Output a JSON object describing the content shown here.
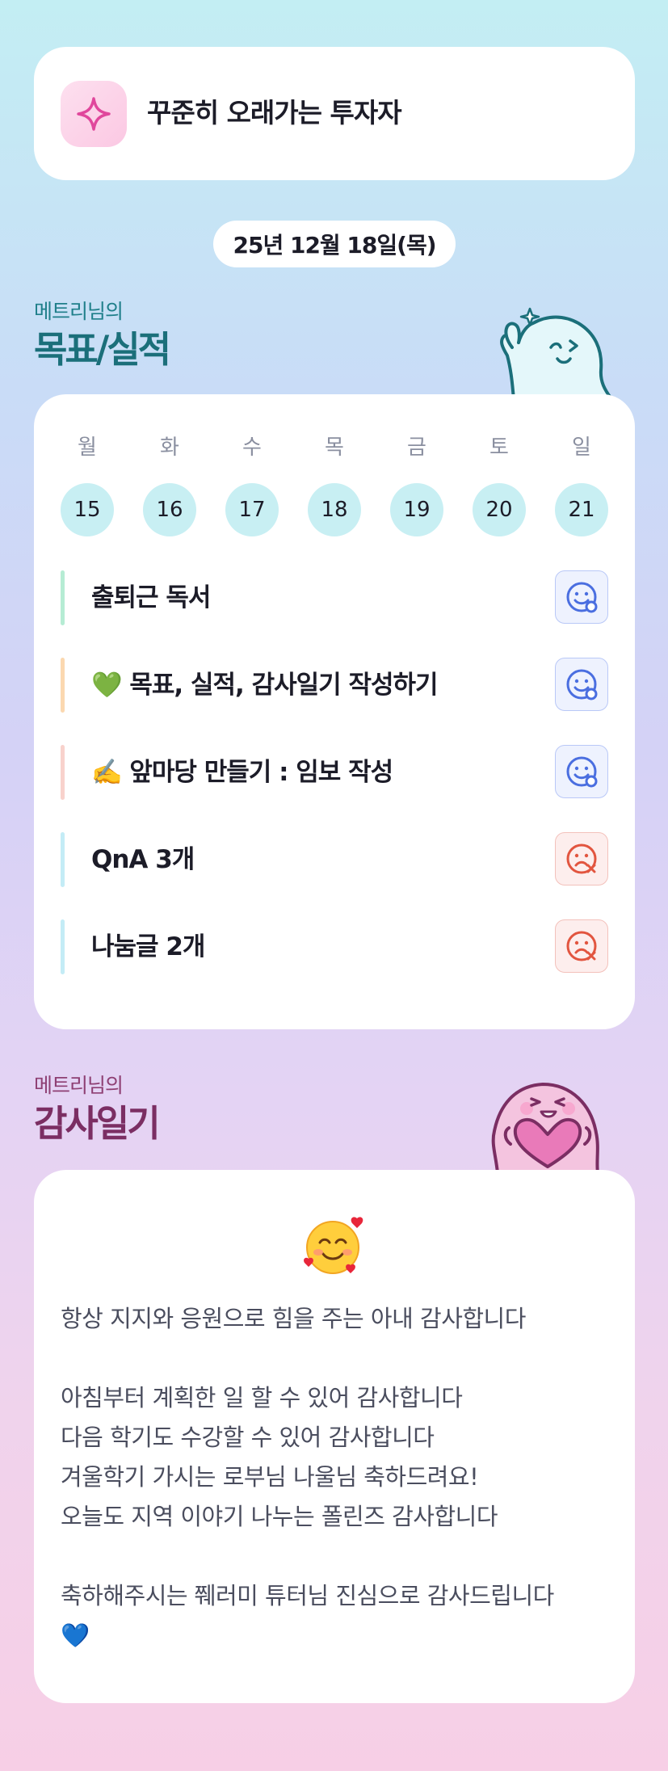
{
  "profile": {
    "title": "꾸준히 오래가는 투자자",
    "icon": "sparkle-icon",
    "accent": "#e0479c"
  },
  "date": "25년 12월 18일(목)",
  "goals_section": {
    "subtitle": "메트리님의",
    "title": "목표/실적"
  },
  "days": [
    {
      "label": "월",
      "num": "15"
    },
    {
      "label": "화",
      "num": "16"
    },
    {
      "label": "수",
      "num": "17"
    },
    {
      "label": "목",
      "num": "18"
    },
    {
      "label": "금",
      "num": "19"
    },
    {
      "label": "토",
      "num": "20"
    },
    {
      "label": "일",
      "num": "21"
    }
  ],
  "goals": [
    {
      "text": "출퇴근 독서",
      "bar_color": "#b6ecd4",
      "status": "done"
    },
    {
      "text": "💚 목표, 실적, 감사일기 작성하기",
      "bar_color": "#fbd8b0",
      "status": "done"
    },
    {
      "text": "✍️ 앞마당 만들기 : 임보 작성",
      "bar_color": "#f8d2cc",
      "status": "done"
    },
    {
      "text": "QnA 3개",
      "bar_color": "#c4ecf6",
      "status": "not-done"
    },
    {
      "text": "나눔글 2개",
      "bar_color": "#c4ecf6",
      "status": "not-done"
    }
  ],
  "thanks_section": {
    "subtitle": "메트리님의",
    "title": "감사일기"
  },
  "thanks": {
    "emoji": "smiling-face-with-hearts-icon",
    "text": "항상 지지와 응원으로 힘을 주는 아내 감사합니다\n\n아침부터 계획한 일 할 수 있어 감사합니다\n다음 학기도 수강할 수 있어 감사합니다\n겨울학기 가시는 로부님 나울님 축하드려요!\n오늘도 지역 이야기 나누는 폴린즈 감사합니다\n\n축하해주시는 쮀러미 튜터님 진심으로 감사드립니다\n💙"
  },
  "colors": {
    "done": "#4a6ee0",
    "not_done": "#e2553f",
    "day_circle": "#c8eff3"
  }
}
